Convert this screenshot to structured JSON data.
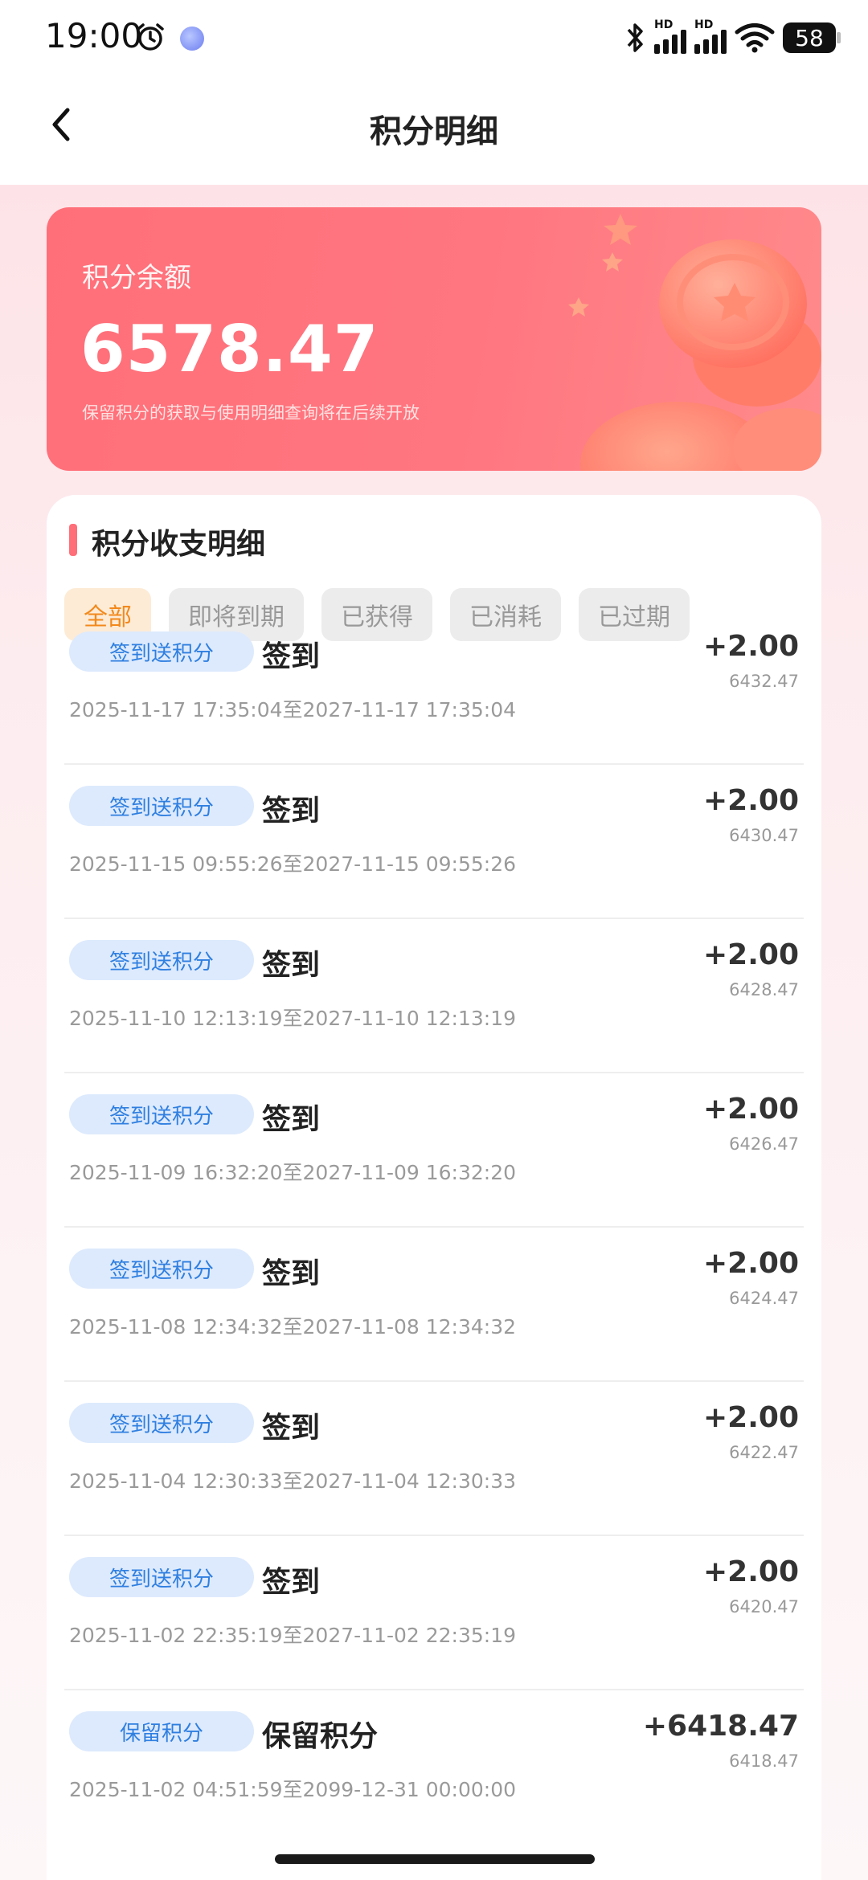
{
  "status_bar": {
    "time": "19:00",
    "battery": "58",
    "icons": [
      "alarm-icon",
      "app-notification-icon",
      "bluetooth-icon",
      "signal-hd-icon",
      "signal-hd-icon",
      "wifi-icon",
      "battery-icon"
    ],
    "hd_label": "HD"
  },
  "header": {
    "title": "积分明细",
    "back_icon": "chevron-left-icon"
  },
  "balance_card": {
    "label": "积分余额",
    "value": "6578.47",
    "note": "保留积分的获取与使用明细查询将在后续开放",
    "accent_color": "#ff6f79"
  },
  "details": {
    "section_title": "积分收支明细",
    "filters": [
      {
        "label": "全部",
        "active": true
      },
      {
        "label": "即将到期",
        "active": false
      },
      {
        "label": "已获得",
        "active": false
      },
      {
        "label": "已消耗",
        "active": false
      },
      {
        "label": "已过期",
        "active": false
      }
    ],
    "records": [
      {
        "badge": "签到送积分",
        "title": "签到",
        "amount": "+2.00",
        "balance": "6432.47",
        "time": "2025-11-17 17:35:04至2027-11-17 17:35:04"
      },
      {
        "badge": "签到送积分",
        "title": "签到",
        "amount": "+2.00",
        "balance": "6430.47",
        "time": "2025-11-15 09:55:26至2027-11-15 09:55:26"
      },
      {
        "badge": "签到送积分",
        "title": "签到",
        "amount": "+2.00",
        "balance": "6428.47",
        "time": "2025-11-10 12:13:19至2027-11-10 12:13:19"
      },
      {
        "badge": "签到送积分",
        "title": "签到",
        "amount": "+2.00",
        "balance": "6426.47",
        "time": "2025-11-09 16:32:20至2027-11-09 16:32:20"
      },
      {
        "badge": "签到送积分",
        "title": "签到",
        "amount": "+2.00",
        "balance": "6424.47",
        "time": "2025-11-08 12:34:32至2027-11-08 12:34:32"
      },
      {
        "badge": "签到送积分",
        "title": "签到",
        "amount": "+2.00",
        "balance": "6422.47",
        "time": "2025-11-04 12:30:33至2027-11-04 12:30:33"
      },
      {
        "badge": "签到送积分",
        "title": "签到",
        "amount": "+2.00",
        "balance": "6420.47",
        "time": "2025-11-02 22:35:19至2027-11-02 22:35:19"
      },
      {
        "badge": "保留积分",
        "title": "保留积分",
        "amount": "+6418.47",
        "balance": "6418.47",
        "time": "2025-11-02 04:51:59至2099-12-31 00:00:00"
      }
    ]
  },
  "colors": {
    "badge_bg": "#ddeafd",
    "badge_text": "#2f7fe0",
    "active_filter_text": "#f2891c",
    "active_filter_bg": "#fdebd6"
  }
}
